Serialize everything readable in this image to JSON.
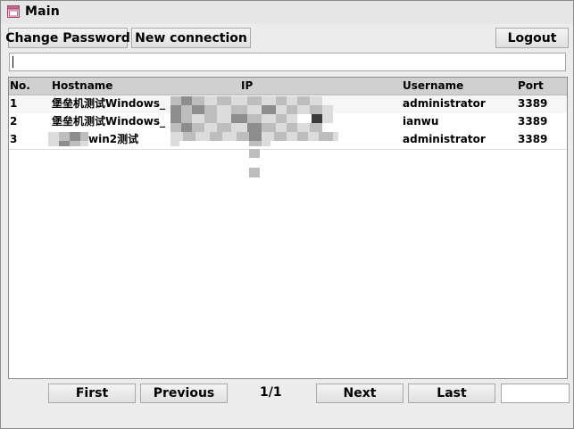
{
  "window": {
    "title": "Main"
  },
  "toolbar": {
    "change_password": "Change Password",
    "new_connection": "New connection",
    "logout": "Logout"
  },
  "search": {
    "value": ""
  },
  "table": {
    "headers": {
      "no": "No.",
      "hostname": "Hostname",
      "ip": "IP",
      "username": "Username",
      "port": "Port"
    },
    "rows": [
      {
        "no": "1",
        "hostname": "堡垒机测试Windows_",
        "ip": "",
        "username": "administrator",
        "port": "3389"
      },
      {
        "no": "2",
        "hostname": "堡垒机测试Windows_",
        "ip": "",
        "username": "ianwu",
        "port": "3389"
      },
      {
        "no": "3",
        "hostname": "win2测试",
        "ip": "",
        "username": "administrator",
        "port": "3389"
      }
    ]
  },
  "pager": {
    "first": "First",
    "previous": "Previous",
    "page_indicator": "1/1",
    "next": "Next",
    "last": "Last",
    "page_input_value": ""
  }
}
